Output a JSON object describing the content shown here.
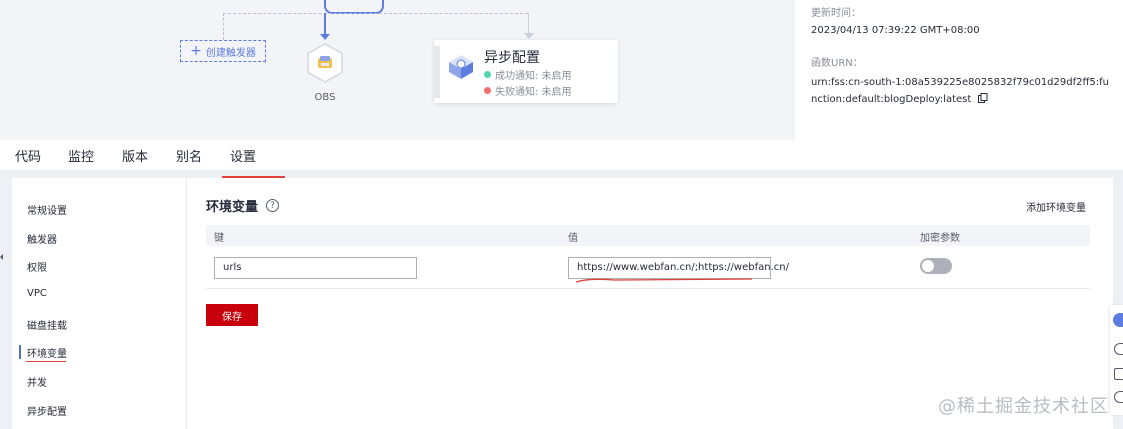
{
  "info": {
    "updated_label": "更新时间：",
    "updated_value": "2023/04/13 07:39:22 GMT+08:00",
    "urn_label": "函数URN：",
    "urn_value": "urn:fss:cn-south-1:08a539225e8025832f79c01d29df2ff5:function:default:blogDeploy:latest"
  },
  "canvas": {
    "create_trigger": "创建触发器",
    "obs_label": "OBS",
    "async_title": "异步配置",
    "success_notice": "成功通知:  未启用",
    "failure_notice": "失败通知:  未启用"
  },
  "tabs": [
    "代码",
    "监控",
    "版本",
    "别名",
    "设置"
  ],
  "active_tab": 4,
  "sidebar": [
    "常规设置",
    "触发器",
    "权限",
    "VPC",
    "磁盘挂载",
    "环境变量",
    "并发",
    "异步配置"
  ],
  "active_sidebar": 5,
  "env": {
    "title": "环境变量",
    "add_label": "添加环境变量",
    "col_key": "键",
    "col_value": "值",
    "col_encrypt": "加密参数",
    "row_key": "urls",
    "row_value": "https://www.webfan.cn/;https://webfan.cn/",
    "encrypt_enabled": false,
    "save_label": "保存"
  },
  "watermark": "@稀土掘金技术社区",
  "colors": {
    "accent": "#5e7ce0",
    "save": "#c7000b",
    "success_dot": "#50d4ab",
    "fail_dot": "#f66f6a"
  }
}
